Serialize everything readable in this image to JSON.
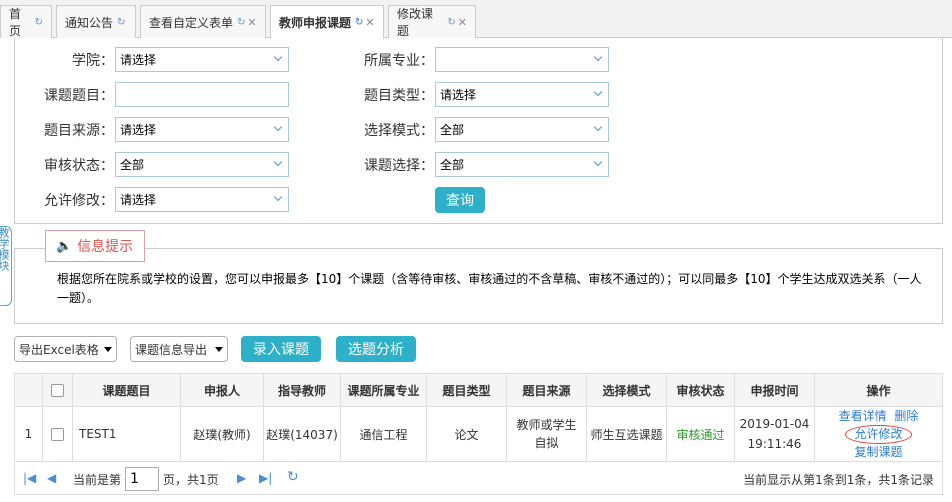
{
  "tabs": [
    {
      "label": "首页",
      "closable": false
    },
    {
      "label": "通知公告",
      "closable": false
    },
    {
      "label": "查看自定义表单",
      "closable": true
    },
    {
      "label": "教师申报课题",
      "closable": true
    },
    {
      "label": "修改课题",
      "closable": false
    }
  ],
  "filters": {
    "college": {
      "label": "学院：",
      "value": "请选择"
    },
    "major": {
      "label": "所属专业：",
      "value": ""
    },
    "topic_title": {
      "label": "课题题目：",
      "value": ""
    },
    "topic_type": {
      "label": "题目类型：",
      "value": "请选择"
    },
    "topic_source": {
      "label": "题目来源：",
      "value": "请选择"
    },
    "select_mode": {
      "label": "选择模式：",
      "value": "全部"
    },
    "review_status": {
      "label": "审核状态：",
      "value": "全部"
    },
    "topic_selection": {
      "label": "课题选择：",
      "value": "全部"
    },
    "allow_modify": {
      "label": "允许修改：",
      "value": "请选择"
    },
    "query_button": "查询"
  },
  "side_tab": "教学模块",
  "info": {
    "title": "信息提示",
    "text": "根据您所在院系或学校的设置，您可以申报最多【10】个课题（含等待审核、审核通过的不含草稿、审核不通过的）；可以同最多【10】个学生达成双选关系（一人一题）。"
  },
  "toolbar": {
    "export_excel": "导出Excel表格",
    "export_info": "课题信息导出",
    "add_topic": "录入课题",
    "analysis": "选题分析"
  },
  "table": {
    "headers": [
      "",
      "",
      "课题题目",
      "申报人",
      "指导教师",
      "课题所属专业",
      "题目类型",
      "题目来源",
      "选择模式",
      "审核状态",
      "申报时间",
      "操作"
    ],
    "rows": [
      {
        "num": "1",
        "title": "TEST1",
        "applicant": "赵璞(教师)",
        "advisor": "赵璞(14037)",
        "major": "通信工程",
        "type": "论文",
        "source": "教师或学生自拟",
        "mode": "师生互选课题",
        "status": "审核通过",
        "date": "2019-01-04",
        "time": "19:11:46",
        "ops": [
          "查看详情",
          "删除",
          "允许修改",
          "复制课题"
        ]
      }
    ]
  },
  "pager": {
    "current_prefix": "当前是第",
    "page": "1",
    "suffix": "页，共1页",
    "summary": "当前显示从第1条到1条，共1条记录"
  },
  "colors": {
    "accent": "#2fb0c9",
    "ok": "#2a9a2a",
    "link": "#2c7dcf",
    "alert": "#d9534f"
  }
}
